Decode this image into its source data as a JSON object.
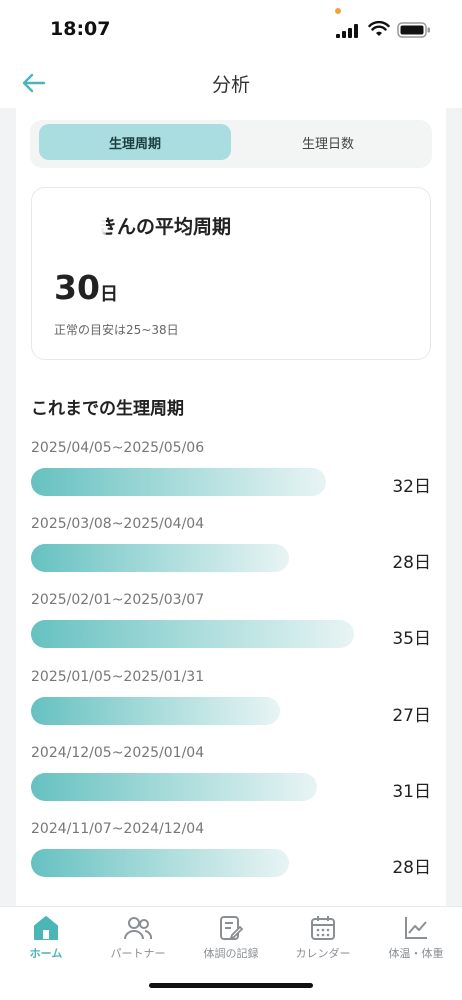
{
  "status_bar": {
    "time": "18:07"
  },
  "header": {
    "title": "分析"
  },
  "tabs": [
    {
      "label": "生理周期",
      "active": true
    },
    {
      "label": "生理日数",
      "active": false
    }
  ],
  "average_card": {
    "title": "きんの平均周期",
    "value": "30",
    "unit": "日",
    "note": "正常の目安は25~38日"
  },
  "history": {
    "title": "これまでの生理周期",
    "max_days": 35,
    "cycles": [
      {
        "range": "2025/04/05~2025/05/06",
        "days": 32,
        "label": "32日"
      },
      {
        "range": "2025/03/08~2025/04/04",
        "days": 28,
        "label": "28日"
      },
      {
        "range": "2025/02/01~2025/03/07",
        "days": 35,
        "label": "35日"
      },
      {
        "range": "2025/01/05~2025/01/31",
        "days": 27,
        "label": "27日"
      },
      {
        "range": "2024/12/05~2025/01/04",
        "days": 31,
        "label": "31日"
      },
      {
        "range": "2024/11/07~2024/12/04",
        "days": 28,
        "label": "28日"
      }
    ]
  },
  "bottom_nav": [
    {
      "label": "ホーム",
      "icon": "home-icon",
      "active": true
    },
    {
      "label": "パートナー",
      "icon": "partner-icon",
      "active": false
    },
    {
      "label": "体調の記録",
      "icon": "record-icon",
      "active": false
    },
    {
      "label": "カレンダー",
      "icon": "calendar-icon",
      "active": false
    },
    {
      "label": "体温・体重",
      "icon": "chart-icon",
      "active": false
    }
  ],
  "colors": {
    "accent": "#4cb5b8",
    "tab_active_bg": "#a9dddf",
    "bar_start": "#66c1c1",
    "bar_end": "#e8f4f4"
  }
}
